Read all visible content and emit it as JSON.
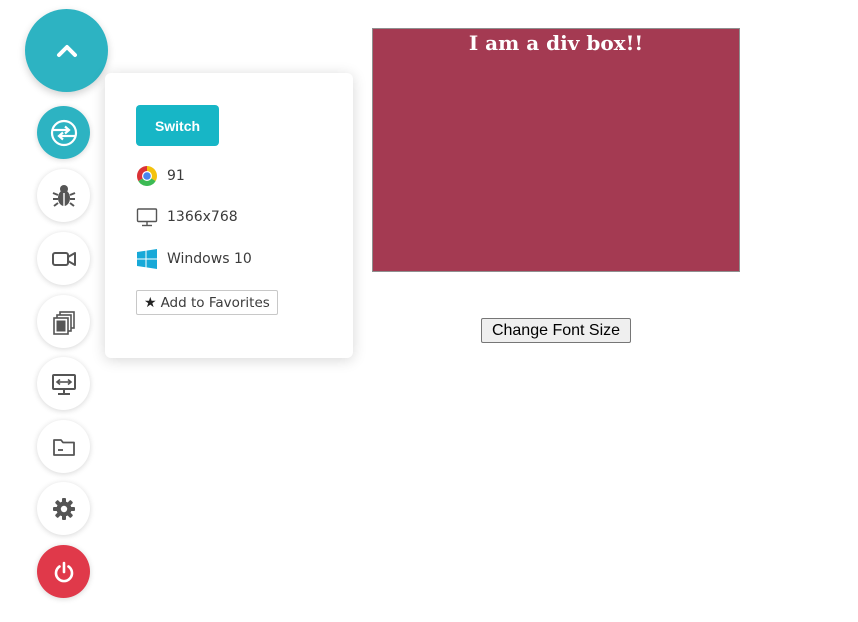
{
  "toolbar": {
    "collapse_icon": "chevron-up-icon",
    "items": [
      {
        "name": "switch-browser",
        "icon": "switch-icon",
        "active": true
      },
      {
        "name": "bug-report",
        "icon": "bug-icon"
      },
      {
        "name": "video-recording",
        "icon": "video-camera-icon"
      },
      {
        "name": "screenshot",
        "icon": "gallery-icon"
      },
      {
        "name": "screen-resolution",
        "icon": "monitor-icon"
      },
      {
        "name": "file-manager",
        "icon": "folder-icon"
      },
      {
        "name": "settings",
        "icon": "gear-icon"
      },
      {
        "name": "end-session",
        "icon": "power-icon",
        "color": "#e0394a"
      }
    ],
    "accent_color": "#2db3c2"
  },
  "panel": {
    "switch_label": "Switch",
    "browser_version": "91",
    "resolution": "1366x768",
    "os": "Windows 10",
    "favorites_label": "Add to Favorites"
  },
  "content": {
    "div_box_text": "I am a div box!!",
    "div_box_color": "#a43a52",
    "change_font_button": "Change Font Size"
  }
}
